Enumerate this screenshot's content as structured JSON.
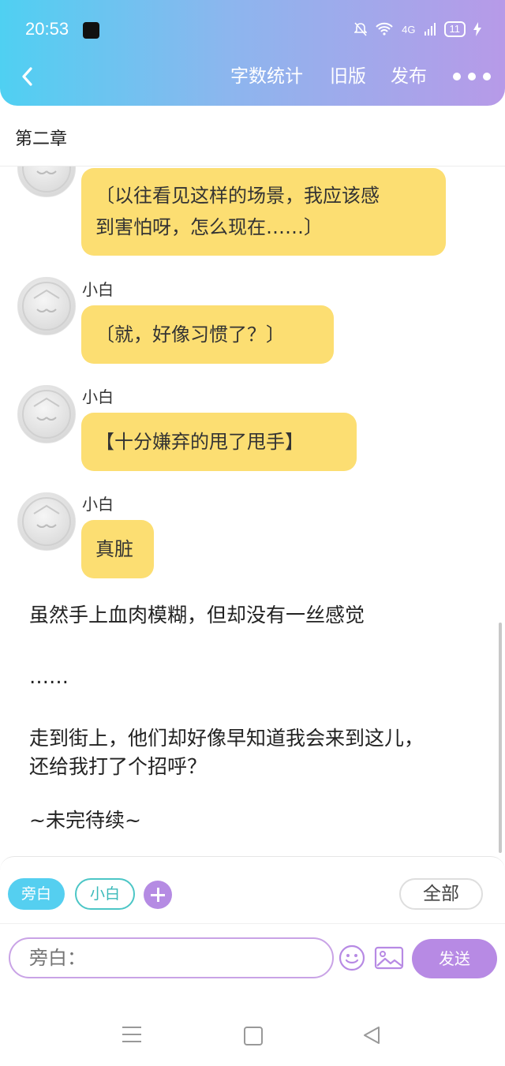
{
  "status_bar": {
    "time": "20:53",
    "network": "4G",
    "battery": "11"
  },
  "nav": {
    "word_count": "字数统计",
    "old_version": "旧版",
    "publish": "发布"
  },
  "chapter": {
    "title": "第二章"
  },
  "messages": [
    {
      "speaker": "",
      "lines": [
        "〔以往看见这样的场景，我应该感",
        "到害怕呀，怎么现在……〕"
      ]
    },
    {
      "speaker": "小白",
      "lines": [
        "〔就，好像习惯了？〕"
      ]
    },
    {
      "speaker": "小白",
      "lines": [
        "【十分嫌弃的甩了甩手】"
      ]
    },
    {
      "speaker": "小白",
      "lines": [
        "真脏"
      ]
    }
  ],
  "narration": [
    "虽然手上血肉模糊，但却没有一丝感觉",
    "……",
    "走到街上，他们却好像早知道我会来到这儿，",
    "还给我打了个招呼？",
    "~未完待续~"
  ],
  "composer": {
    "chip_narrator": "旁白",
    "chip_role": "小白",
    "chip_all": "全部",
    "input_placeholder": "旁白：",
    "send": "发送"
  },
  "colors": {
    "bubble": "#fcde72",
    "accent": "#b78ae4",
    "chip_active": "#55cff0"
  }
}
